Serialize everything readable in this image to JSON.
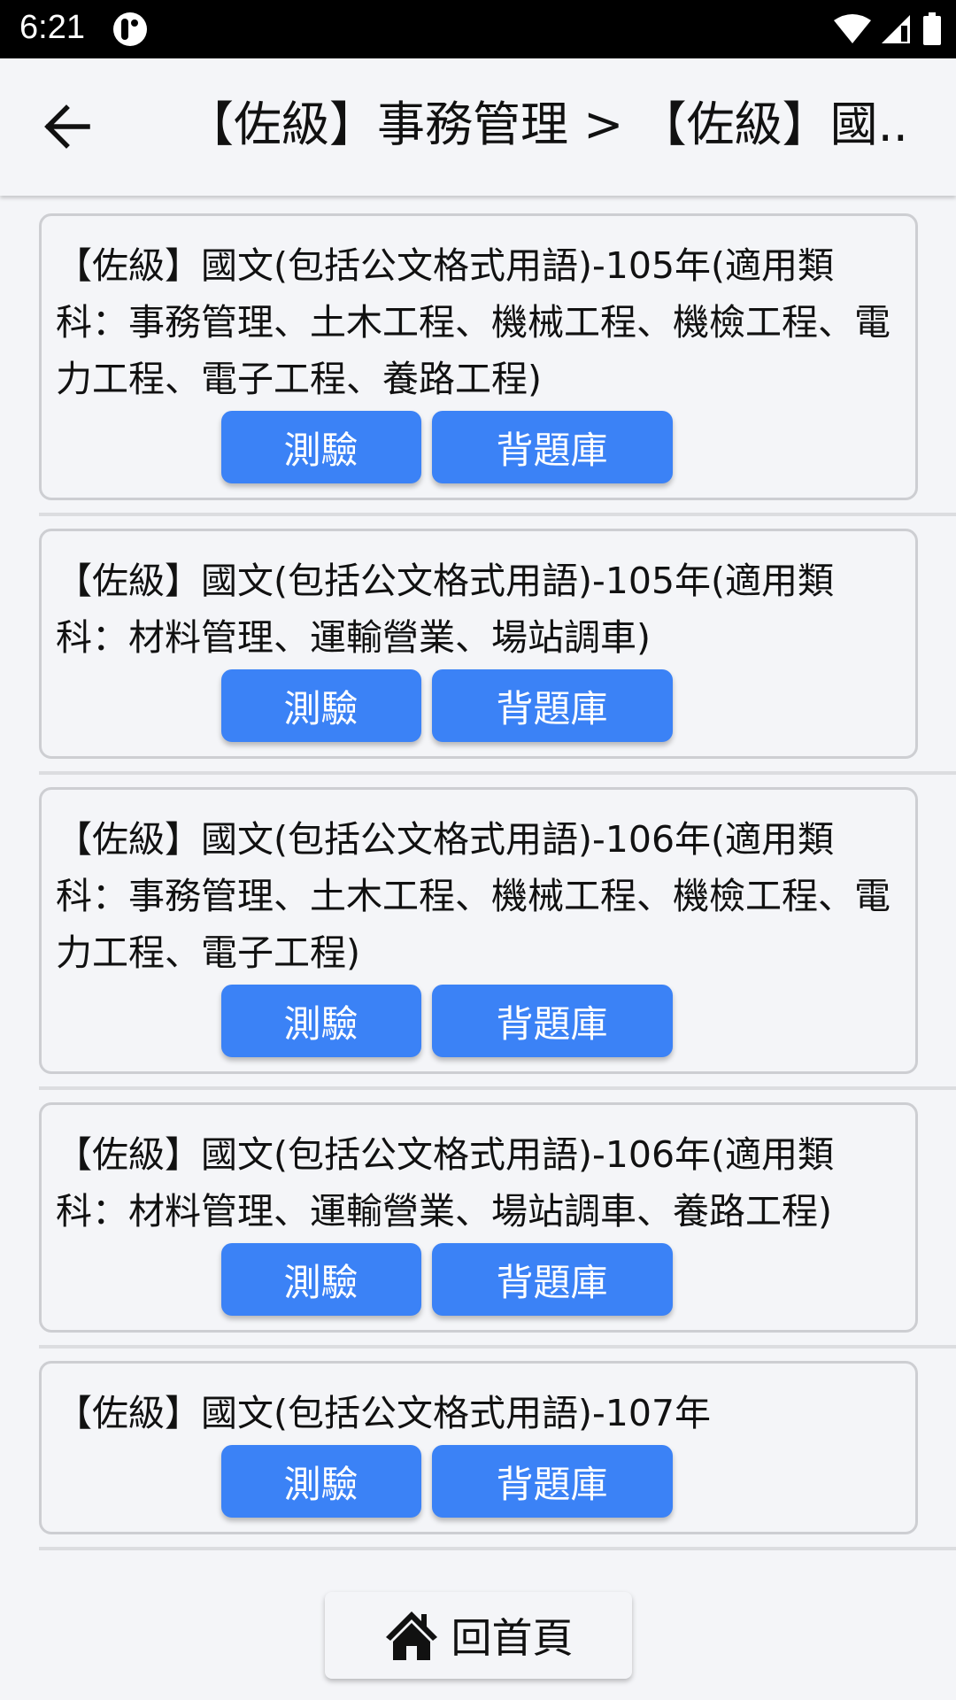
{
  "status_bar": {
    "time": "6:21",
    "icons": [
      "app-notification-icon",
      "wifi-icon",
      "cell-signal-icon",
      "battery-icon"
    ]
  },
  "app_bar": {
    "back_icon": "arrow-left-icon",
    "title": "【佐級】事務管理 > 【佐級】國..."
  },
  "items": [
    {
      "title": "【佐級】國文(包括公文格式用語)-105年(適用類科：事務管理、土木工程、機械工程、機檢工程、電力工程、電子工程、養路工程)",
      "test_label": "測驗",
      "bank_label": "背題庫"
    },
    {
      "title": "【佐級】國文(包括公文格式用語)-105年(適用類科：材料管理、運輸營業、場站調車)",
      "test_label": "測驗",
      "bank_label": "背題庫"
    },
    {
      "title": "【佐級】國文(包括公文格式用語)-106年(適用類科：事務管理、土木工程、機械工程、機檢工程、電力工程、電子工程)",
      "test_label": "測驗",
      "bank_label": "背題庫"
    },
    {
      "title": "【佐級】國文(包括公文格式用語)-106年(適用類科：材料管理、運輸營業、場站調車、養路工程)",
      "test_label": "測驗",
      "bank_label": "背題庫"
    },
    {
      "title": "【佐級】國文(包括公文格式用語)-107年",
      "test_label": "測驗",
      "bank_label": "背題庫"
    }
  ],
  "home_button": {
    "icon": "home-icon",
    "label": "回首頁"
  },
  "colors": {
    "primary_button": "#3b82f6",
    "background": "#f4f5f8",
    "status_bar": "#000000"
  }
}
